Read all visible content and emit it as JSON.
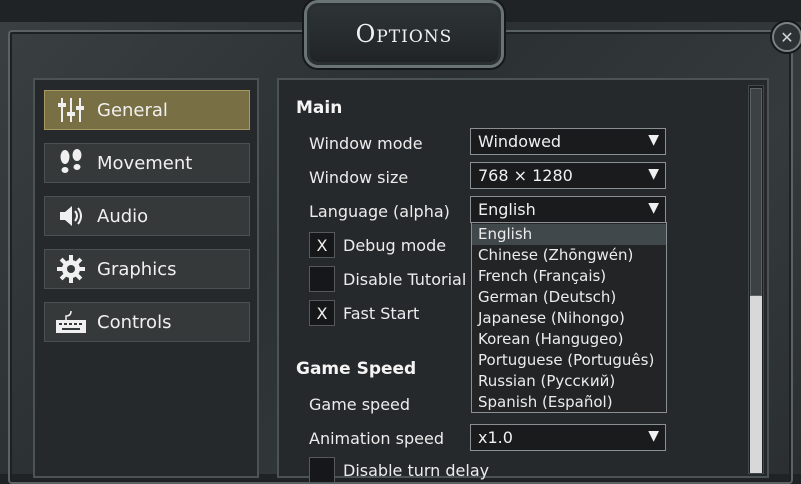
{
  "window": {
    "title": "Options",
    "close_icon": "close-icon"
  },
  "sidebar": {
    "items": [
      {
        "label": "General",
        "icon": "sliders-icon",
        "active": true
      },
      {
        "label": "Movement",
        "icon": "footprints-icon",
        "active": false
      },
      {
        "label": "Audio",
        "icon": "speaker-icon",
        "active": false
      },
      {
        "label": "Graphics",
        "icon": "gear-icon",
        "active": false
      },
      {
        "label": "Controls",
        "icon": "keyboard-icon",
        "active": false
      }
    ]
  },
  "main": {
    "section_main": "Main",
    "window_mode": {
      "label": "Window mode",
      "value": "Windowed"
    },
    "window_size": {
      "label": "Window size",
      "value": "768 × 1280"
    },
    "language": {
      "label": "Language (alpha)",
      "value": "English",
      "options": [
        "English",
        "Chinese (Zhōngwén)",
        "French (Français)",
        "German (Deutsch)",
        "Japanese (Nihongo)",
        "Korean (Hangugeo)",
        "Portuguese (Português)",
        "Russian (Русский)",
        "Spanish (Español)"
      ]
    },
    "debug_mode": {
      "label": "Debug mode",
      "checked": true,
      "mark": "X"
    },
    "disable_tutorial": {
      "label": "Disable Tutorial",
      "checked": false
    },
    "fast_start": {
      "label": "Fast Start",
      "checked": true,
      "mark": "X"
    },
    "section_game_speed": "Game Speed",
    "game_speed": {
      "label": "Game speed"
    },
    "animation_speed": {
      "label": "Animation speed",
      "value": "x1.0"
    },
    "disable_turn_delay": {
      "label": "Disable turn delay",
      "checked": false
    }
  },
  "colors": {
    "active_tab": "#786f45",
    "panel_bg": "#26292b",
    "frame": "#2b3032"
  }
}
